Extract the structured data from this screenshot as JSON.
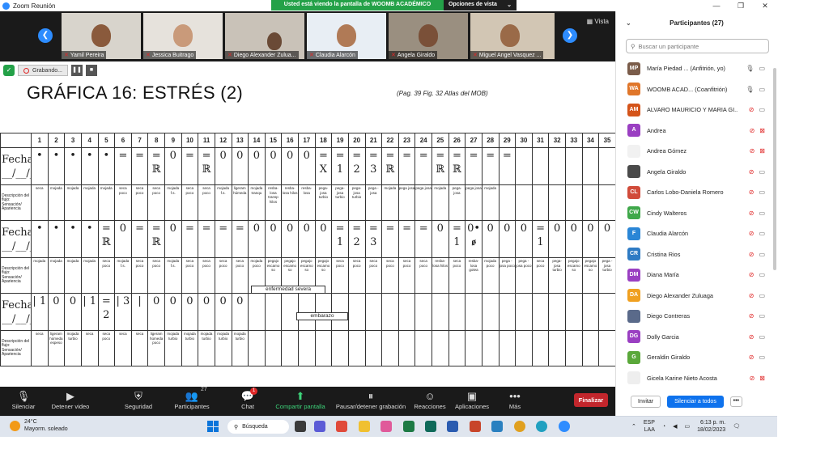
{
  "window": {
    "title": "Zoom Reunión"
  },
  "share_banner": {
    "message": "Usted está viendo la pantalla de WOOMB ACADÉMICO",
    "options_label": "Opciones de vista"
  },
  "video_strip": {
    "view_label": "Vista",
    "tiles": [
      {
        "name": "Yamil Pereira"
      },
      {
        "name": "Jessica Buitrago"
      },
      {
        "name": "Diego Alexander Zulua..."
      },
      {
        "name": "Claudia Alarcón"
      },
      {
        "name": "Angela Giraldo"
      },
      {
        "name": "Miguel Angel Vasquez ..."
      }
    ]
  },
  "recording": {
    "label": "Grabando..."
  },
  "document": {
    "title": "GRÁFICA 16:  ESTRÉS (2)",
    "reference": "(Pag. 39  Fig. 32 Atlas del MOB)",
    "day_numbers": [
      "1",
      "2",
      "3",
      "4",
      "5",
      "6",
      "7",
      "8",
      "9",
      "10",
      "11",
      "12",
      "13",
      "14",
      "15",
      "16",
      "17",
      "18",
      "19",
      "20",
      "21",
      "22",
      "23",
      "24",
      "25",
      "26",
      "27",
      "28",
      "29",
      "30",
      "31",
      "32",
      "33",
      "34",
      "35"
    ],
    "row_labels": {
      "fecha": "Fecha __/__/__",
      "descripcion": "Descripción del flujo: Sensación/ Apariencia"
    },
    "rows": [
      {
        "symbols": [
          "•",
          "•",
          "•",
          "•",
          "•",
          "=",
          "=",
          "= ℝ",
          "0",
          "=",
          "= ℝ",
          "0",
          "0",
          "0",
          "0",
          "0",
          "0",
          "= X",
          "= 1",
          "= 2",
          "= 3",
          "= ℝ",
          "=",
          "=",
          "= ℝ",
          "= ℝ",
          "=",
          "=",
          "=",
          "",
          "",
          "",
          "",
          "",
          ""
        ],
        "desc": [
          "seca",
          "mojada",
          "mojada",
          "mojada",
          "mojada",
          "seca poco",
          "seca poco",
          "seca poco",
          "mojada f.s.",
          "seca poco",
          "seca poco",
          "mojada f.s.",
          "ligeram húmeda",
          "mojada tranqu",
          "resba- losa transp hilos",
          "resba- losa hilos",
          "resba- losa",
          "pega- josa turbio",
          "pega- josa turbio",
          "pega- josa turbio",
          "pega - josa",
          "mojada",
          "pega josa",
          "pega josa",
          "mojada",
          "pega- josa",
          "pega josa",
          "mojada",
          "",
          "",
          "",
          "",
          "",
          "",
          ""
        ]
      },
      {
        "symbols": [
          "•",
          "•",
          "•",
          "•",
          "= ℝ",
          "0",
          "=",
          "= ℝ",
          "0",
          "=",
          "=",
          "=",
          "=",
          "0",
          "0",
          "0",
          "0",
          "0",
          "= 1",
          "= 2",
          "= 3",
          "=",
          "=",
          "=",
          "0",
          "= 1",
          "0• ꬾ",
          "0",
          "0",
          "0",
          "= 1",
          "0",
          "0",
          "0",
          "0"
        ],
        "desc": [
          "mojada",
          "mojada",
          "mojada",
          "mojada",
          "seca poco",
          "mojada f.s.",
          "seca poco",
          "seca poco",
          "mojada f.s.",
          "seca poco",
          "seca poco",
          "seca poco",
          "seca poco",
          "mojada poco",
          "pegajo escamo so",
          "pegajo escamo so",
          "pegajo escamo so",
          "pegajo escamo so",
          "seca poco",
          "seca poco",
          "seca poco",
          "seca poco",
          "seca poco",
          "seca poco",
          "resba- losa hilos",
          "seca poco",
          "resba- losa gotea",
          "mojada poco",
          "pega - josa poco",
          "pega - josa poco",
          "seca poco",
          "pega- josa turbio",
          "pegajo escamo so",
          "pegajo escamo so",
          "pega - josa turbio"
        ]
      },
      {
        "symbols": [
          "| 1",
          "0",
          "0",
          "| 1",
          "= 2",
          "| 3",
          "|",
          "0",
          "0",
          "0",
          "0",
          "0",
          "0",
          "",
          "",
          "",
          "",
          "",
          "",
          "",
          "",
          "",
          "",
          "",
          "",
          "",
          "",
          "",
          "",
          "",
          "",
          "",
          "",
          "",
          ""
        ],
        "desc": [
          "seca",
          "ligeram húmeda espeso",
          "mojada turbio",
          "seca",
          "seca poco",
          "seca",
          "seca",
          "ligeram húmeda poco",
          "mojada turbio",
          "mojada turbio",
          "mojada turbio",
          "mojada turbio",
          "mojada turbio",
          "",
          "",
          "",
          "",
          "",
          "",
          "",
          "",
          "",
          "",
          "",
          "",
          "",
          "",
          "",
          "",
          "",
          "",
          "",
          "",
          "",
          ""
        ]
      }
    ],
    "annotations": {
      "severe": "enfermedad severa",
      "pregnancy": "embarazo"
    }
  },
  "toolbar": {
    "mute": "Silenciar",
    "video": "Detener video",
    "security": "Seguridad",
    "participants": "Participantes",
    "participants_count": "27",
    "chat": "Chat",
    "chat_badge": "1",
    "share": "Compartir pantalla",
    "pause_rec": "Pausar/detener grabación",
    "reactions": "Reacciones",
    "apps": "Aplicaciones",
    "more": "Más",
    "end": "Finalizar"
  },
  "participants_panel": {
    "title": "Participantes (27)",
    "search_placeholder": "Buscar un participante",
    "invite": "Invitar",
    "mute_all": "Silenciar a todos",
    "list": [
      {
        "initials": "MP",
        "name": "María Piedad ... (Anfitrión, yo)",
        "color": "#7a5c4a",
        "mic_on": true,
        "cam_on": true
      },
      {
        "initials": "WA",
        "name": "WOOMB ACAD... (Coanfitrión)",
        "color": "#e0762a",
        "mic_on": true,
        "cam_on": true
      },
      {
        "initials": "AM",
        "name": "ALVARO MAURICIO Y MARIA GI...",
        "color": "#d4541a",
        "mic_on": false,
        "cam_on": true
      },
      {
        "initials": "A",
        "name": "Andrea",
        "color": "#9a3fc2",
        "mic_on": false,
        "cam_on": false
      },
      {
        "initials": "",
        "name": "Andrea Gómez",
        "color": "#f1f1f1",
        "mic_on": false,
        "cam_on": false
      },
      {
        "initials": "",
        "name": "Angela Giraldo",
        "color": "#4a4a4a",
        "mic_on": false,
        "cam_on": true
      },
      {
        "initials": "CL",
        "name": "Carlos Lobo-Daniela Romero",
        "color": "#d14b3a",
        "mic_on": false,
        "cam_on": true
      },
      {
        "initials": "CW",
        "name": "Cindy Walteros",
        "color": "#3fa84a",
        "mic_on": false,
        "cam_on": true
      },
      {
        "initials": "F",
        "name": "Claudia Alarcón",
        "color": "#2a86d6",
        "mic_on": false,
        "cam_on": true
      },
      {
        "initials": "CR",
        "name": "Cristina Rios",
        "color": "#2e7bc4",
        "mic_on": false,
        "cam_on": true
      },
      {
        "initials": "DM",
        "name": "Diana María",
        "color": "#9a3fc2",
        "mic_on": false,
        "cam_on": true
      },
      {
        "initials": "DA",
        "name": "Diego Alexander Zuluaga",
        "color": "#f0a020",
        "mic_on": false,
        "cam_on": true
      },
      {
        "initials": "",
        "name": "Diego Contreras",
        "color": "#5a6a8a",
        "mic_on": false,
        "cam_on": true
      },
      {
        "initials": "DG",
        "name": "Dolly Garcia",
        "color": "#9a3fc2",
        "mic_on": false,
        "cam_on": true
      },
      {
        "initials": "G",
        "name": "Geraldin Giraldo",
        "color": "#5aa83a",
        "mic_on": false,
        "cam_on": true
      },
      {
        "initials": "",
        "name": "Gicela Karine Nieto Acosta",
        "color": "#eeeeee",
        "mic_on": false,
        "cam_on": false
      }
    ]
  },
  "taskbar": {
    "temperature": "24°C",
    "weather": "Mayorm. soleado",
    "search": "Búsqueda",
    "lang1": "ESP",
    "lang2": "LAA",
    "time": "6:13 p. m.",
    "date": "18/02/2023"
  }
}
